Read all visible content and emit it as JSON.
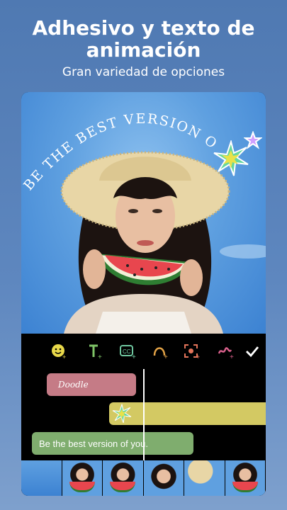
{
  "headline": {
    "line1": "Adhesivo y texto de",
    "line2": "animación",
    "subtitle": "Gran variedad de opciones"
  },
  "photo": {
    "overlay_text": "BE THE BEST VERSION OF YOU.",
    "sticker_icon": "sparkle-burst-icon",
    "star_icon": "star-outline-icon"
  },
  "toolbar": {
    "items": [
      {
        "icon": "emoji-add-icon",
        "color": "#e8d84a"
      },
      {
        "icon": "text-add-icon",
        "color": "#7fc468"
      },
      {
        "icon": "caption-add-icon",
        "color": "#6fc7a0"
      },
      {
        "icon": "curve-text-icon",
        "color": "#e3a347"
      },
      {
        "icon": "face-focus-icon",
        "color": "#e3745a"
      },
      {
        "icon": "doodle-add-icon",
        "color": "#d9608c"
      },
      {
        "icon": "confirm-check-icon",
        "color": "#ffffff"
      }
    ]
  },
  "timeline": {
    "doodle_clip_label": "Doodle",
    "text_clip_label": "Be the best version of you.",
    "doodle_color": "#c57b86",
    "sticker_color": "#d3c963",
    "text_color": "#7fad6e"
  },
  "colors": {
    "background": "#5e87bf",
    "panel": "#000000"
  }
}
